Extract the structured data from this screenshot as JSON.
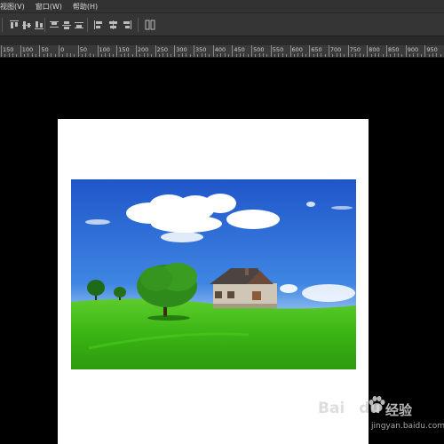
{
  "menu": {
    "items": [
      {
        "label": "视图(V)"
      },
      {
        "label": "窗口(W)"
      },
      {
        "label": "帮助(H)"
      }
    ]
  },
  "options_bar": {
    "tools": [
      {
        "icon": "align-top-edges-icon"
      },
      {
        "icon": "align-vertical-centers-icon"
      },
      {
        "icon": "align-bottom-edges-icon"
      },
      {
        "icon": "distribute-top-icon"
      },
      {
        "icon": "distribute-vertical-centers-icon"
      },
      {
        "icon": "distribute-bottom-icon"
      },
      {
        "icon": "align-left-edges-icon"
      },
      {
        "icon": "align-horizontal-centers-icon"
      },
      {
        "icon": "align-right-edges-icon"
      },
      {
        "icon": "auto-align-layers-icon"
      }
    ]
  },
  "ruler": {
    "labels": [
      "150",
      "100",
      "50",
      "0",
      "50",
      "100",
      "150",
      "200",
      "250",
      "300",
      "350",
      "400",
      "450",
      "500",
      "550",
      "600",
      "650",
      "700",
      "750",
      "800",
      "850",
      "900",
      "950"
    ]
  },
  "document": {
    "image": "landscape-house-on-green-field"
  },
  "watermark": {
    "brand": "Bai",
    "brand_tail": "du",
    "brand_cn": "经验",
    "site": "jingyan.baidu.com"
  },
  "colors": {
    "ui_dark": "#323232",
    "canvas": "#000000",
    "sky_top": "#2f6fd6",
    "grass": "#3fbf1a"
  }
}
